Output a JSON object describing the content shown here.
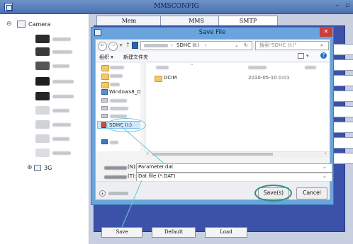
{
  "window": {
    "title": "MMSCONFIG",
    "minimize": "–",
    "restore": "▫"
  },
  "tree": {
    "root": {
      "label": "Camera",
      "expander": "⊖"
    },
    "item_3g": {
      "label": "3G",
      "expander": "⊕"
    }
  },
  "tabs": [
    {
      "label": "Mem",
      "active": false
    },
    {
      "label": "MMS",
      "active": false
    },
    {
      "label": "SMTP",
      "active": true
    }
  ],
  "bottom_buttons": {
    "save": "Save",
    "default": "Default",
    "load": "Load"
  },
  "dialog": {
    "title": "Save File",
    "close": "✕",
    "nav": {
      "back": "←",
      "forward": "→",
      "up": "↑"
    },
    "address": "SDHC (I:)",
    "address_sep": "›",
    "refresh": "↻",
    "search_placeholder": "搜索\"SDHC (I:)\"",
    "toolbar": {
      "organize": "组织 ▾",
      "new_folder": "新建文件夹",
      "help": "?"
    },
    "nav_items": {
      "windows8": "Windows8_OS (",
      "sdhc": "SDHC (I:)"
    },
    "files": [
      {
        "name": "DCIM",
        "date": "2010-05-10 0:01"
      }
    ],
    "filename_label": "(N):",
    "filename_value": "Parameter.dat",
    "filetype_label": "(T):",
    "filetype_value": "Dat file (*.DAT)",
    "buttons": {
      "save": "Save(s)",
      "cancel": "Cancel"
    }
  },
  "colors": {
    "accent": "#3b52a8",
    "callout": "#2f8f88"
  }
}
